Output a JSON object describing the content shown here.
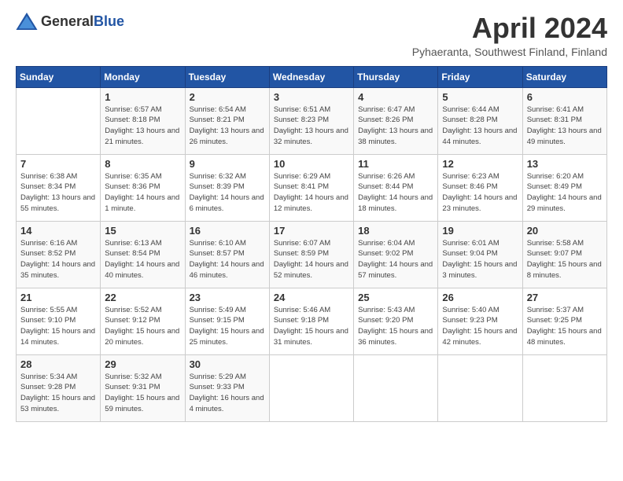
{
  "header": {
    "logo": {
      "text_general": "General",
      "text_blue": "Blue"
    },
    "month": "April 2024",
    "location": "Pyhaeranta, Southwest Finland, Finland"
  },
  "weekdays": [
    "Sunday",
    "Monday",
    "Tuesday",
    "Wednesday",
    "Thursday",
    "Friday",
    "Saturday"
  ],
  "weeks": [
    [
      {
        "day": "",
        "sunrise": "",
        "sunset": "",
        "daylight": ""
      },
      {
        "day": "1",
        "sunrise": "Sunrise: 6:57 AM",
        "sunset": "Sunset: 8:18 PM",
        "daylight": "Daylight: 13 hours and 21 minutes."
      },
      {
        "day": "2",
        "sunrise": "Sunrise: 6:54 AM",
        "sunset": "Sunset: 8:21 PM",
        "daylight": "Daylight: 13 hours and 26 minutes."
      },
      {
        "day": "3",
        "sunrise": "Sunrise: 6:51 AM",
        "sunset": "Sunset: 8:23 PM",
        "daylight": "Daylight: 13 hours and 32 minutes."
      },
      {
        "day": "4",
        "sunrise": "Sunrise: 6:47 AM",
        "sunset": "Sunset: 8:26 PM",
        "daylight": "Daylight: 13 hours and 38 minutes."
      },
      {
        "day": "5",
        "sunrise": "Sunrise: 6:44 AM",
        "sunset": "Sunset: 8:28 PM",
        "daylight": "Daylight: 13 hours and 44 minutes."
      },
      {
        "day": "6",
        "sunrise": "Sunrise: 6:41 AM",
        "sunset": "Sunset: 8:31 PM",
        "daylight": "Daylight: 13 hours and 49 minutes."
      }
    ],
    [
      {
        "day": "7",
        "sunrise": "Sunrise: 6:38 AM",
        "sunset": "Sunset: 8:34 PM",
        "daylight": "Daylight: 13 hours and 55 minutes."
      },
      {
        "day": "8",
        "sunrise": "Sunrise: 6:35 AM",
        "sunset": "Sunset: 8:36 PM",
        "daylight": "Daylight: 14 hours and 1 minute."
      },
      {
        "day": "9",
        "sunrise": "Sunrise: 6:32 AM",
        "sunset": "Sunset: 8:39 PM",
        "daylight": "Daylight: 14 hours and 6 minutes."
      },
      {
        "day": "10",
        "sunrise": "Sunrise: 6:29 AM",
        "sunset": "Sunset: 8:41 PM",
        "daylight": "Daylight: 14 hours and 12 minutes."
      },
      {
        "day": "11",
        "sunrise": "Sunrise: 6:26 AM",
        "sunset": "Sunset: 8:44 PM",
        "daylight": "Daylight: 14 hours and 18 minutes."
      },
      {
        "day": "12",
        "sunrise": "Sunrise: 6:23 AM",
        "sunset": "Sunset: 8:46 PM",
        "daylight": "Daylight: 14 hours and 23 minutes."
      },
      {
        "day": "13",
        "sunrise": "Sunrise: 6:20 AM",
        "sunset": "Sunset: 8:49 PM",
        "daylight": "Daylight: 14 hours and 29 minutes."
      }
    ],
    [
      {
        "day": "14",
        "sunrise": "Sunrise: 6:16 AM",
        "sunset": "Sunset: 8:52 PM",
        "daylight": "Daylight: 14 hours and 35 minutes."
      },
      {
        "day": "15",
        "sunrise": "Sunrise: 6:13 AM",
        "sunset": "Sunset: 8:54 PM",
        "daylight": "Daylight: 14 hours and 40 minutes."
      },
      {
        "day": "16",
        "sunrise": "Sunrise: 6:10 AM",
        "sunset": "Sunset: 8:57 PM",
        "daylight": "Daylight: 14 hours and 46 minutes."
      },
      {
        "day": "17",
        "sunrise": "Sunrise: 6:07 AM",
        "sunset": "Sunset: 8:59 PM",
        "daylight": "Daylight: 14 hours and 52 minutes."
      },
      {
        "day": "18",
        "sunrise": "Sunrise: 6:04 AM",
        "sunset": "Sunset: 9:02 PM",
        "daylight": "Daylight: 14 hours and 57 minutes."
      },
      {
        "day": "19",
        "sunrise": "Sunrise: 6:01 AM",
        "sunset": "Sunset: 9:04 PM",
        "daylight": "Daylight: 15 hours and 3 minutes."
      },
      {
        "day": "20",
        "sunrise": "Sunrise: 5:58 AM",
        "sunset": "Sunset: 9:07 PM",
        "daylight": "Daylight: 15 hours and 8 minutes."
      }
    ],
    [
      {
        "day": "21",
        "sunrise": "Sunrise: 5:55 AM",
        "sunset": "Sunset: 9:10 PM",
        "daylight": "Daylight: 15 hours and 14 minutes."
      },
      {
        "day": "22",
        "sunrise": "Sunrise: 5:52 AM",
        "sunset": "Sunset: 9:12 PM",
        "daylight": "Daylight: 15 hours and 20 minutes."
      },
      {
        "day": "23",
        "sunrise": "Sunrise: 5:49 AM",
        "sunset": "Sunset: 9:15 PM",
        "daylight": "Daylight: 15 hours and 25 minutes."
      },
      {
        "day": "24",
        "sunrise": "Sunrise: 5:46 AM",
        "sunset": "Sunset: 9:18 PM",
        "daylight": "Daylight: 15 hours and 31 minutes."
      },
      {
        "day": "25",
        "sunrise": "Sunrise: 5:43 AM",
        "sunset": "Sunset: 9:20 PM",
        "daylight": "Daylight: 15 hours and 36 minutes."
      },
      {
        "day": "26",
        "sunrise": "Sunrise: 5:40 AM",
        "sunset": "Sunset: 9:23 PM",
        "daylight": "Daylight: 15 hours and 42 minutes."
      },
      {
        "day": "27",
        "sunrise": "Sunrise: 5:37 AM",
        "sunset": "Sunset: 9:25 PM",
        "daylight": "Daylight: 15 hours and 48 minutes."
      }
    ],
    [
      {
        "day": "28",
        "sunrise": "Sunrise: 5:34 AM",
        "sunset": "Sunset: 9:28 PM",
        "daylight": "Daylight: 15 hours and 53 minutes."
      },
      {
        "day": "29",
        "sunrise": "Sunrise: 5:32 AM",
        "sunset": "Sunset: 9:31 PM",
        "daylight": "Daylight: 15 hours and 59 minutes."
      },
      {
        "day": "30",
        "sunrise": "Sunrise: 5:29 AM",
        "sunset": "Sunset: 9:33 PM",
        "daylight": "Daylight: 16 hours and 4 minutes."
      },
      {
        "day": "",
        "sunrise": "",
        "sunset": "",
        "daylight": ""
      },
      {
        "day": "",
        "sunrise": "",
        "sunset": "",
        "daylight": ""
      },
      {
        "day": "",
        "sunrise": "",
        "sunset": "",
        "daylight": ""
      },
      {
        "day": "",
        "sunrise": "",
        "sunset": "",
        "daylight": ""
      }
    ]
  ]
}
